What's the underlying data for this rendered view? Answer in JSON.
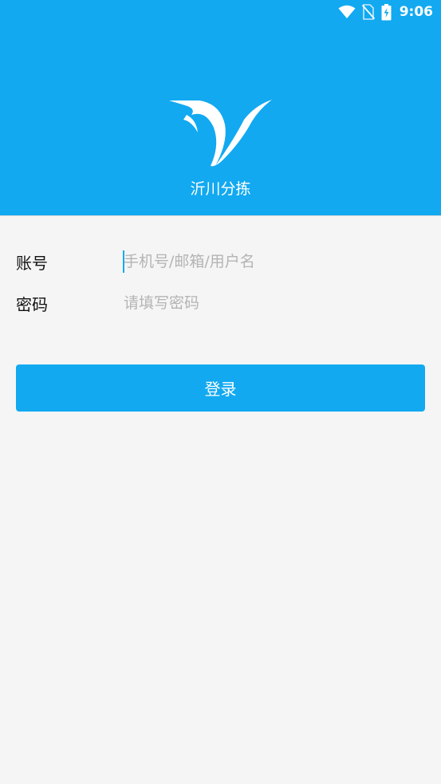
{
  "status_bar": {
    "time": "9:06",
    "icons": [
      "wifi-icon",
      "no-sim-icon",
      "battery-charging-icon"
    ]
  },
  "header": {
    "app_name": "沂川分拣",
    "logo": "bird-logo"
  },
  "form": {
    "account_label": "账号",
    "account_placeholder": "手机号/邮箱/用户名",
    "account_value": "",
    "password_label": "密码",
    "password_placeholder": "请填写密码",
    "password_value": ""
  },
  "login_button": {
    "label": "登录"
  },
  "colors": {
    "brand": "#12a9f1",
    "background": "#f5f5f5",
    "placeholder": "#b4b4b4"
  }
}
